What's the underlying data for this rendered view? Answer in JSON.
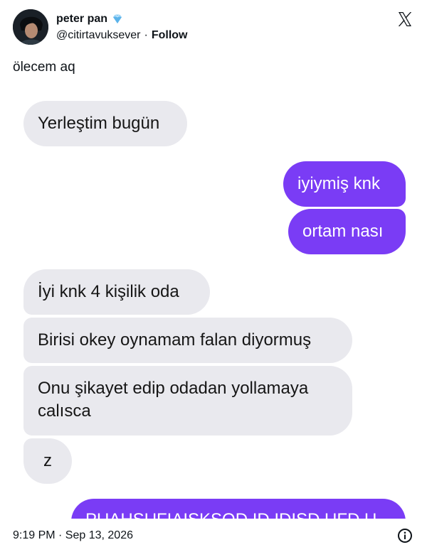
{
  "author": {
    "display_name": "peter pan",
    "handle": "@citirtavuksever",
    "separator": "·",
    "follow_label": "Follow",
    "badge_icon": "diamond-icon"
  },
  "platform_icon": "x-logo-icon",
  "tweet": {
    "text": "ölecem aq"
  },
  "chat": {
    "colors": {
      "incoming": "#e9e9ee",
      "outgoing": "#7a3cf5"
    },
    "messages": [
      {
        "side": "in",
        "text": "Yerleştim bugün"
      },
      {
        "side": "out",
        "text": "iyiymiş knk"
      },
      {
        "side": "out",
        "text": "ortam nası"
      },
      {
        "side": "in",
        "text": "İyi knk 4 kişilik oda"
      },
      {
        "side": "in",
        "text": "Birisi okey oynamam falan diyormuş"
      },
      {
        "side": "in",
        "text": "Onu şikayet edip odadan yollamaya calısca"
      },
      {
        "side": "in",
        "text": "z"
      },
      {
        "side": "out",
        "text": "PUAHSUFIAISKSOD ID IDISD UFD U"
      }
    ]
  },
  "footer": {
    "timestamp": "9:19 PM · Sep 13, 2026",
    "info_icon": "info-icon"
  }
}
